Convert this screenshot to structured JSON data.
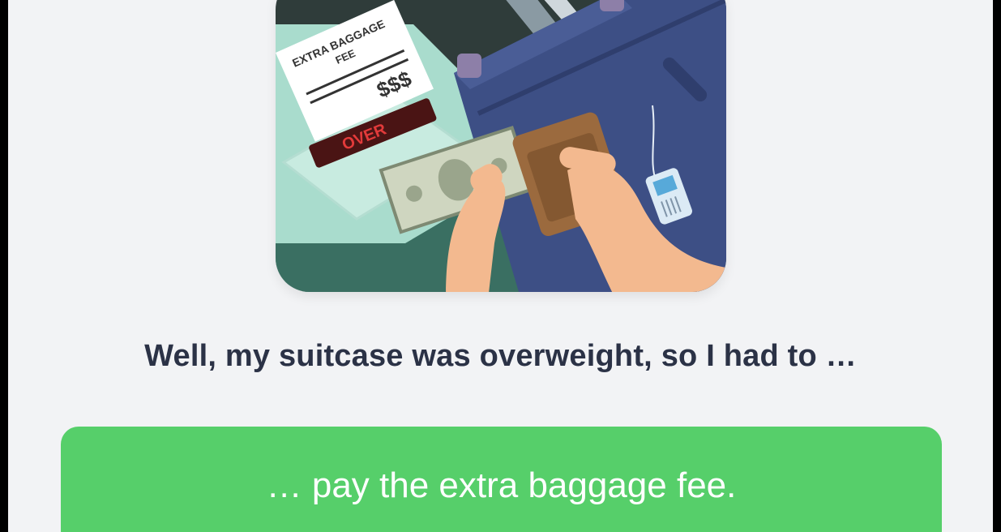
{
  "illustration": {
    "receipt_line1": "EXTRA BAGGAGE",
    "receipt_line2": "FEE",
    "receipt_amount": "$$$",
    "scale_display": "OVER"
  },
  "question": {
    "text": "Well, my suitcase was overweight, so I had to …"
  },
  "answer_option": {
    "label": "… pay the extra baggage fee."
  },
  "colors": {
    "answer_button": "#56cf6a",
    "prompt_text": "#2b3246",
    "background": "#f2f3f5"
  }
}
